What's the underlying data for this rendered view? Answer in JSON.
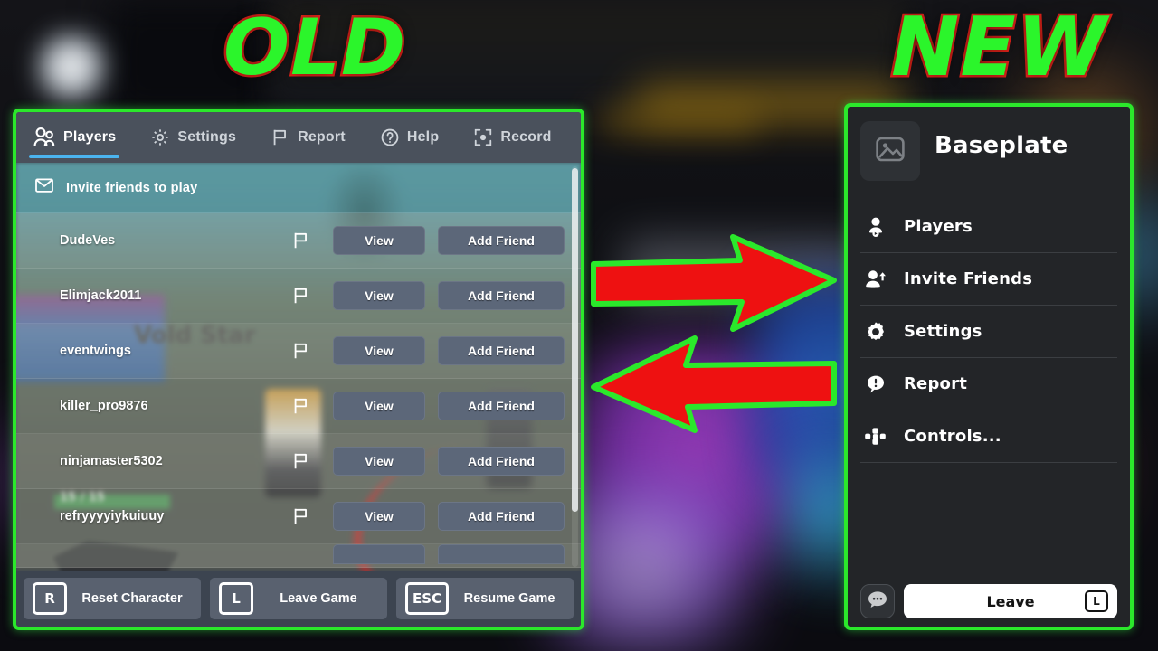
{
  "labels": {
    "old": "OLD",
    "new": "NEW"
  },
  "colors": {
    "frame_green": "#2be82b",
    "headline_fill": "#2bf52b",
    "headline_stroke": "#e8241a",
    "arrow_fill": "#ee1111",
    "arrow_outline": "#2be82b",
    "active_tab_underline": "#4bb4ef",
    "old_panel_bg": "#3c4450",
    "new_panel_bg": "#232528"
  },
  "old_menu": {
    "tabs": [
      {
        "label": "Players",
        "icon": "players-icon",
        "active": true
      },
      {
        "label": "Settings",
        "icon": "gear-icon",
        "active": false
      },
      {
        "label": "Report",
        "icon": "flag-icon",
        "active": false
      },
      {
        "label": "Help",
        "icon": "question-circle-icon",
        "active": false
      },
      {
        "label": "Record",
        "icon": "record-frame-icon",
        "active": false
      }
    ],
    "invite": {
      "label": "Invite friends to play",
      "icon": "envelope-icon"
    },
    "row_buttons": {
      "view": "View",
      "add_friend": "Add Friend",
      "report_icon": "flag-icon"
    },
    "players": [
      {
        "name": "DudeVes"
      },
      {
        "name": "Elimjack2011"
      },
      {
        "name": "eventwings"
      },
      {
        "name": "killer_pro9876"
      },
      {
        "name": "ninjamaster5302"
      },
      {
        "name": "refryyyyiykuiuuy"
      }
    ],
    "footer": [
      {
        "key": "R",
        "label": "Reset Character"
      },
      {
        "key": "L",
        "label": "Leave Game"
      },
      {
        "key": "ESC",
        "label": "Resume Game"
      }
    ],
    "backdrop_text": {
      "billboard": "Vold Star",
      "health": "15 / 15"
    }
  },
  "new_menu": {
    "title": "Baseplate",
    "thumbnail_icon": "image-placeholder-icon",
    "items": [
      {
        "label": "Players",
        "icon": "player-icon"
      },
      {
        "label": "Invite Friends",
        "icon": "person-add-icon"
      },
      {
        "label": "Settings",
        "icon": "gear-icon"
      },
      {
        "label": "Report",
        "icon": "report-alert-icon"
      },
      {
        "label": "Controls...",
        "icon": "dpad-icon"
      }
    ],
    "footer": {
      "chat_icon": "chat-bubble-icon",
      "leave_label": "Leave",
      "leave_key": "L"
    }
  },
  "arrows": [
    {
      "direction": "right",
      "name": "arrow-old-to-new"
    },
    {
      "direction": "left",
      "name": "arrow-new-to-old"
    }
  ]
}
